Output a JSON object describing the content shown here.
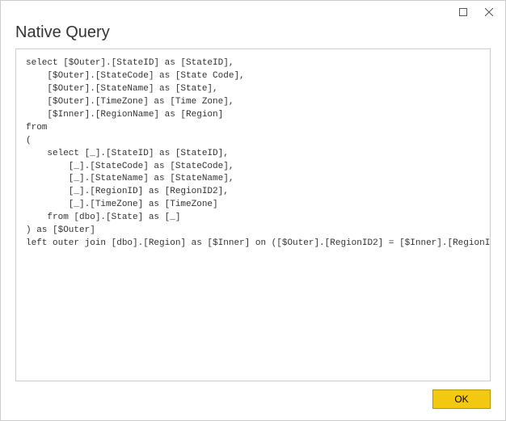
{
  "titlebar": {
    "maximize_name": "maximize",
    "close_name": "close"
  },
  "dialog": {
    "title": "Native Query"
  },
  "query": {
    "text": "select [$Outer].[StateID] as [StateID],\n    [$Outer].[StateCode] as [State Code],\n    [$Outer].[StateName] as [State],\n    [$Outer].[TimeZone] as [Time Zone],\n    [$Inner].[RegionName] as [Region]\nfrom \n(\n    select [_].[StateID] as [StateID],\n        [_].[StateCode] as [StateCode],\n        [_].[StateName] as [StateName],\n        [_].[RegionID] as [RegionID2],\n        [_].[TimeZone] as [TimeZone]\n    from [dbo].[State] as [_]\n) as [$Outer]\nleft outer join [dbo].[Region] as [$Inner] on ([$Outer].[RegionID2] = [$Inner].[RegionID])"
  },
  "footer": {
    "ok_label": "OK"
  }
}
